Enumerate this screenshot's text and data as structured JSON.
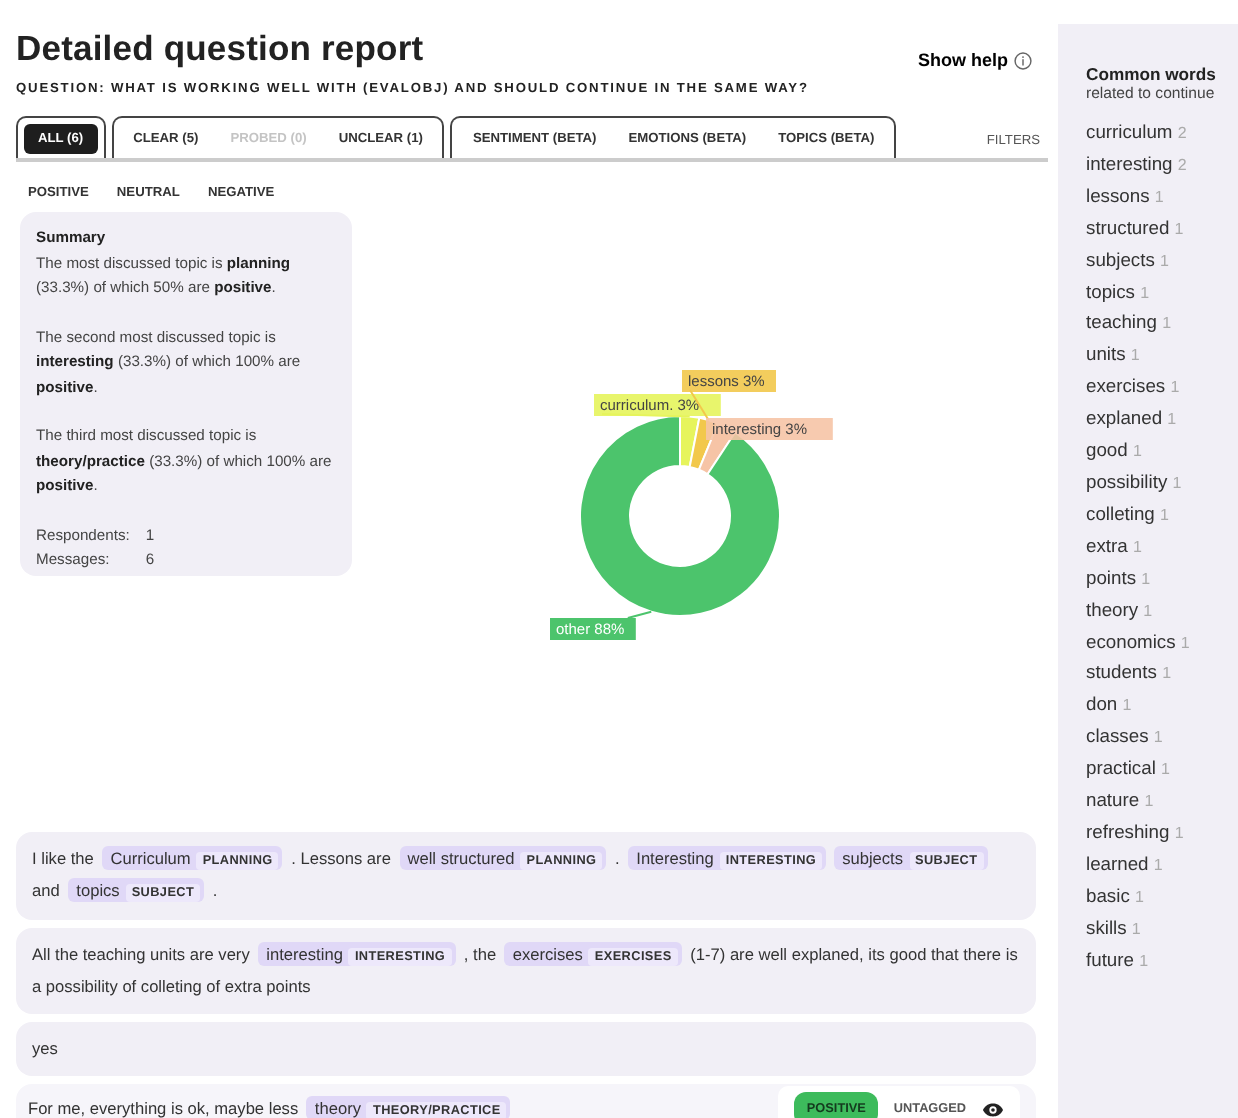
{
  "header": {
    "title": "Detailed question report",
    "help": "Show help",
    "question": "QUESTION: WHAT IS WORKING WELL WITH (EVALOBJ) AND SHOULD CONTINUE IN THE SAME WAY?"
  },
  "tab_groups": [
    {
      "tabs": [
        {
          "label": "ALL (6)",
          "selected": true,
          "disabled": false
        }
      ]
    },
    {
      "tabs": [
        {
          "label": "CLEAR (5)",
          "selected": false,
          "disabled": false
        },
        {
          "label": "PROBED (0)",
          "selected": false,
          "disabled": true
        },
        {
          "label": "UNCLEAR (1)",
          "selected": false,
          "disabled": false
        }
      ]
    },
    {
      "tabs": [
        {
          "label": "SENTIMENT (BETA)",
          "selected": false,
          "disabled": false
        },
        {
          "label": "EMOTIONS (BETA)",
          "selected": false,
          "disabled": false
        },
        {
          "label": "TOPICS (BETA)",
          "selected": false,
          "disabled": false
        }
      ]
    }
  ],
  "filters": "FILTERS",
  "sentiment_tabs": [
    {
      "label": "POSITIVE"
    },
    {
      "label": "NEUTRAL"
    },
    {
      "label": "NEGATIVE"
    }
  ],
  "summary": {
    "title": "Summary",
    "paragraphs": [
      "The most discussed topic is **planning** (33.3%) of which 50% are **positive**.",
      "The second most discussed topic is **interesting** (33.3%) of which 100% are **positive**.",
      "The third most discussed topic is **theory/practice** (33.3%) of which 100% are **positive**."
    ],
    "stats": [
      {
        "label": "Respondents:",
        "value": "1"
      },
      {
        "label": "Messages:",
        "value": "6"
      }
    ]
  },
  "chart_data": {
    "type": "donut",
    "categories": [
      "curriculum.",
      "lessons",
      "interesting",
      "other"
    ],
    "values": [
      3,
      3,
      3,
      88
    ],
    "value_labels": [
      "3%",
      "3%",
      "3%",
      "88%"
    ]
  },
  "messages": [
    {
      "segments": [
        {
          "kind": "text",
          "text": "I like the "
        },
        {
          "kind": "tag",
          "text": "Curriculum",
          "label": "PLANNING"
        },
        {
          "kind": "text",
          "text": " . Lessons are "
        },
        {
          "kind": "tag",
          "text": "well structured",
          "label": "PLANNING"
        },
        {
          "kind": "text",
          "text": " . "
        },
        {
          "kind": "tag",
          "text": "Interesting",
          "label": "INTERESTING"
        },
        {
          "kind": "tag",
          "text": "subjects",
          "label": "SUBJECT"
        },
        {
          "kind": "text",
          "text": " and "
        },
        {
          "kind": "tag",
          "text": "topics",
          "label": "SUBJECT"
        },
        {
          "kind": "text",
          "text": " ."
        }
      ]
    },
    {
      "segments": [
        {
          "kind": "text",
          "text": "All the teaching units are very "
        },
        {
          "kind": "tag",
          "text": "interesting",
          "label": "INTERESTING"
        },
        {
          "kind": "text",
          "text": " , the "
        },
        {
          "kind": "tag",
          "text": "exercises",
          "label": "EXERCISES"
        },
        {
          "kind": "text",
          "text": " (1-7) are well explaned, its good that there is a possibility of colleting of extra points"
        }
      ]
    },
    {
      "segments": [
        {
          "kind": "text",
          "text": "yes"
        }
      ]
    },
    {
      "segments": [
        {
          "kind": "text",
          "text": "For me, everything is ok, maybe less "
        },
        {
          "kind": "tag",
          "text": "theory",
          "label": "THEORY/PRACTICE"
        }
      ],
      "sentiment": {
        "kind": "positive",
        "label": "POSITIVE"
      },
      "status": "UNTAGGED"
    }
  ],
  "sidebar": {
    "title": "Common words",
    "subtitle": "related to continue",
    "words": [
      {
        "word": "curriculum",
        "count": "2"
      },
      {
        "word": "interesting",
        "count": "2"
      },
      {
        "word": "lessons",
        "count": "1"
      },
      {
        "word": "structured",
        "count": "1"
      },
      {
        "word": "subjects",
        "count": "1"
      },
      {
        "word": "topics",
        "count": "1"
      },
      {
        "word": "teaching",
        "count": "1"
      },
      {
        "word": "units",
        "count": "1"
      },
      {
        "word": "exercises",
        "count": "1"
      },
      {
        "word": "explaned",
        "count": "1"
      },
      {
        "word": "good",
        "count": "1"
      },
      {
        "word": "possibility",
        "count": "1"
      },
      {
        "word": "colleting",
        "count": "1"
      },
      {
        "word": "extra",
        "count": "1"
      },
      {
        "word": "points",
        "count": "1"
      },
      {
        "word": "theory",
        "count": "1"
      },
      {
        "word": "economics",
        "count": "1"
      },
      {
        "word": "students",
        "count": "1"
      },
      {
        "word": "don",
        "count": "1"
      },
      {
        "word": "classes",
        "count": "1"
      },
      {
        "word": "practical",
        "count": "1"
      },
      {
        "word": "nature",
        "count": "1"
      },
      {
        "word": "refreshing",
        "count": "1"
      },
      {
        "word": "learned",
        "count": "1"
      },
      {
        "word": "basic",
        "count": "1"
      },
      {
        "word": "skills",
        "count": "1"
      },
      {
        "word": "future",
        "count": "1"
      }
    ]
  }
}
